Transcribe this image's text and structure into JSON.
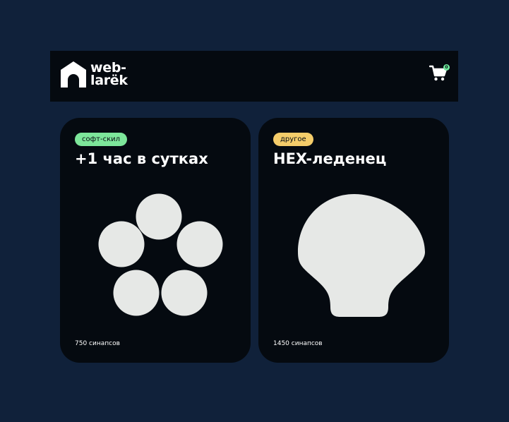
{
  "header": {
    "logo_line1": "web-",
    "logo_line2": "larёk",
    "cart_count": "0"
  },
  "cards": [
    {
      "category": "софт-скил",
      "category_color": "#7de69a",
      "title": "+1 час в сутках",
      "image_icon": "circle-cluster-icon",
      "price": "750 синапсов"
    },
    {
      "category": "другое",
      "category_color": "#f5cd6a",
      "title": "HEX-леденец",
      "image_icon": "shell-lollipop-icon",
      "price": "1450 синапсов"
    }
  ],
  "colors": {
    "background": "#10213a",
    "surface": "#050a10",
    "image_fill": "#e6e8e6"
  }
}
